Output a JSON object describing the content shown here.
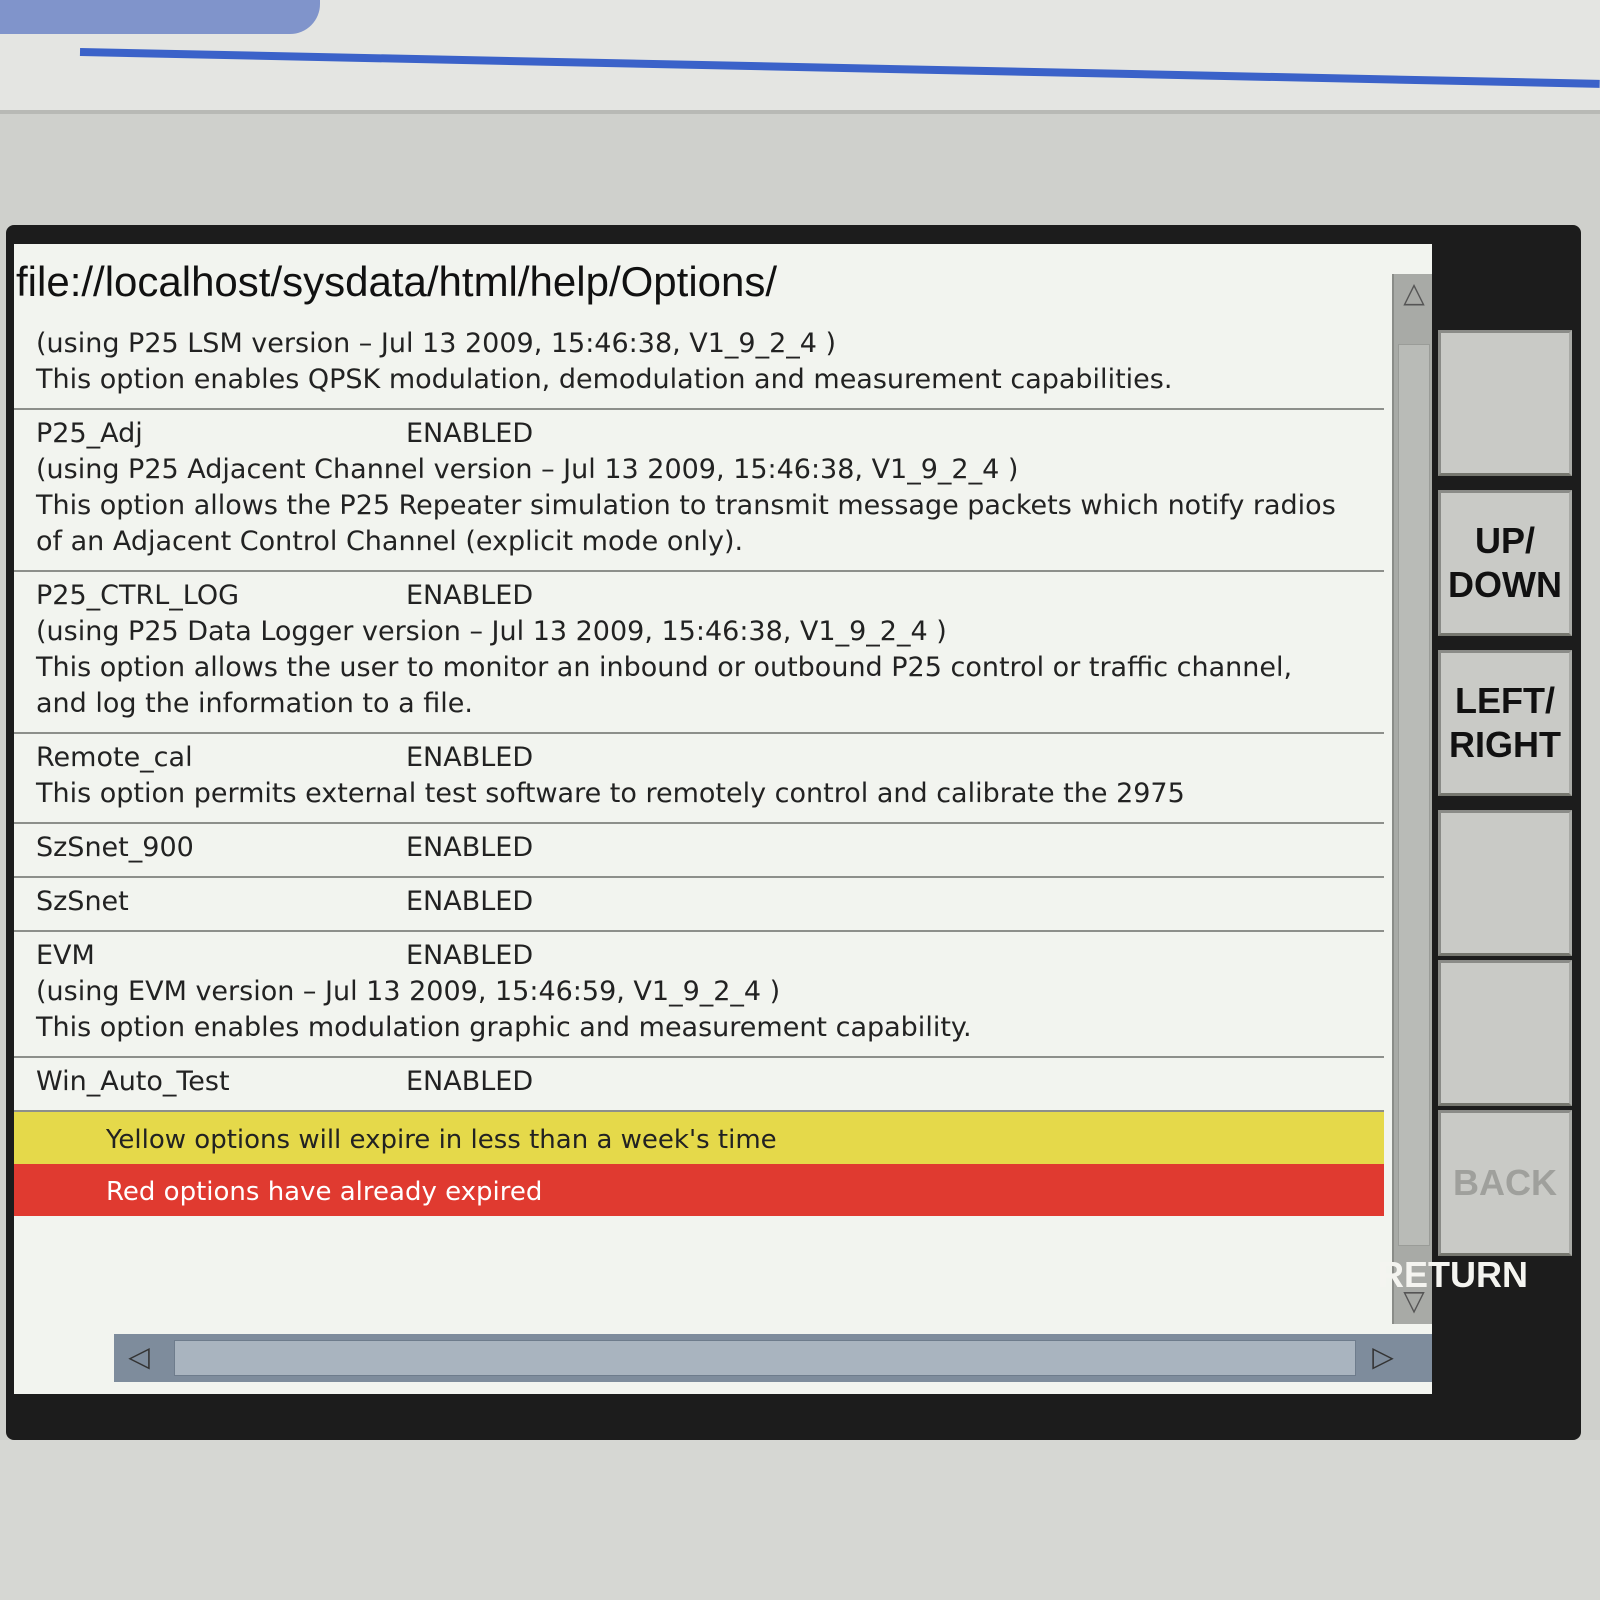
{
  "browser": {
    "url": "file://localhost/sysdata/html/help/Options/"
  },
  "options": [
    {
      "name": "",
      "status": "",
      "lines": [
        "(using P25 LSM version – Jul 13 2009, 15:46:38, V1_9_2_4 )",
        "This option enables QPSK modulation, demodulation and measurement capabilities."
      ]
    },
    {
      "name": "P25_Adj",
      "status": "ENABLED",
      "lines": [
        "(using P25 Adjacent Channel version – Jul 13 2009, 15:46:38, V1_9_2_4 )",
        "This option allows the P25 Repeater simulation to transmit message packets which notify radios",
        "of an Adjacent Control Channel (explicit mode only)."
      ]
    },
    {
      "name": "P25_CTRL_LOG",
      "status": "ENABLED",
      "lines": [
        "(using P25 Data Logger version – Jul 13 2009, 15:46:38, V1_9_2_4 )",
        "This option allows the user to monitor an inbound or outbound P25 control or traffic channel,",
        "and log the information to a file."
      ]
    },
    {
      "name": "Remote_cal",
      "status": "ENABLED",
      "lines": [
        "This option permits external test software to remotely control and calibrate the 2975"
      ]
    },
    {
      "name": "SzSnet_900",
      "status": "ENABLED",
      "lines": []
    },
    {
      "name": "SzSnet",
      "status": "ENABLED",
      "lines": []
    },
    {
      "name": "EVM",
      "status": "ENABLED",
      "lines": [
        "(using EVM version – Jul 13 2009, 15:46:59, V1_9_2_4 )",
        "This option enables modulation graphic and measurement capability."
      ]
    },
    {
      "name": "Win_Auto_Test",
      "status": "ENABLED",
      "lines": []
    }
  ],
  "legend": {
    "yellow": "Yellow options will expire in less than a week's time",
    "red": "Red options have already expired",
    "yellow_color": "#e5d94a",
    "red_color": "#e03a30"
  },
  "softkeys": [
    {
      "label": "",
      "enabled": true
    },
    {
      "label": "UP/\nDOWN",
      "enabled": true
    },
    {
      "label": "LEFT/\nRIGHT",
      "enabled": true
    },
    {
      "label": "",
      "enabled": true
    },
    {
      "label": "",
      "enabled": true
    },
    {
      "label": "BACK",
      "enabled": false
    }
  ],
  "return_label": "RETURN",
  "icons": {
    "scroll_up": "up-triangle-icon",
    "scroll_down": "down-triangle-icon",
    "scroll_left": "left-triangle-icon",
    "scroll_right": "right-triangle-icon"
  }
}
